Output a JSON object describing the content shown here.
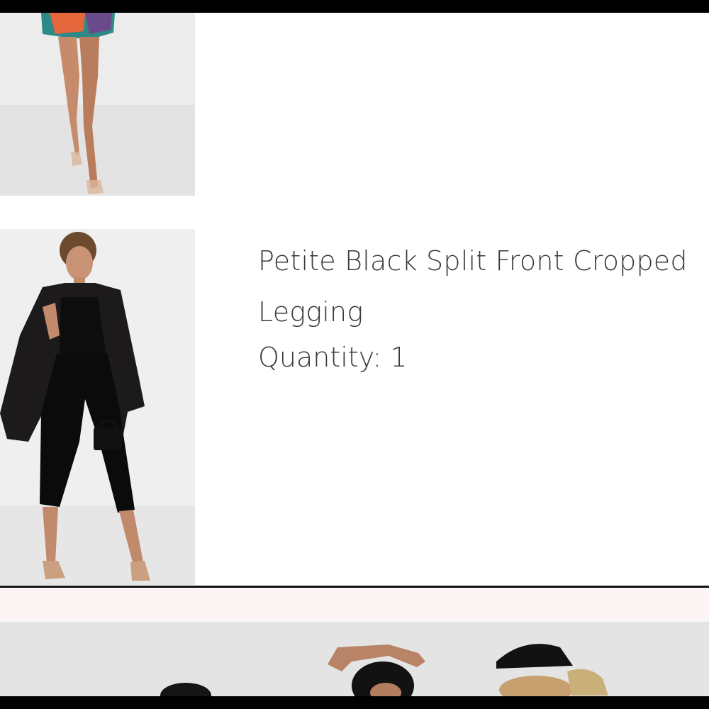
{
  "order_items": [
    {
      "image": "model-wearing-multicolor-print-shorts-and-clear-heels"
    },
    {
      "image": "model-wearing-black-split-front-cropped-legging-with-blazer",
      "name": "Petite Black Split Front Cropped Legging",
      "quantity_label": "Quantity: 1"
    }
  ],
  "banner": {
    "image": "group-of-models-promo-banner"
  },
  "colors": {
    "bar": "#000000",
    "text": "#3a3a3a",
    "band": "#fbf5f6"
  }
}
